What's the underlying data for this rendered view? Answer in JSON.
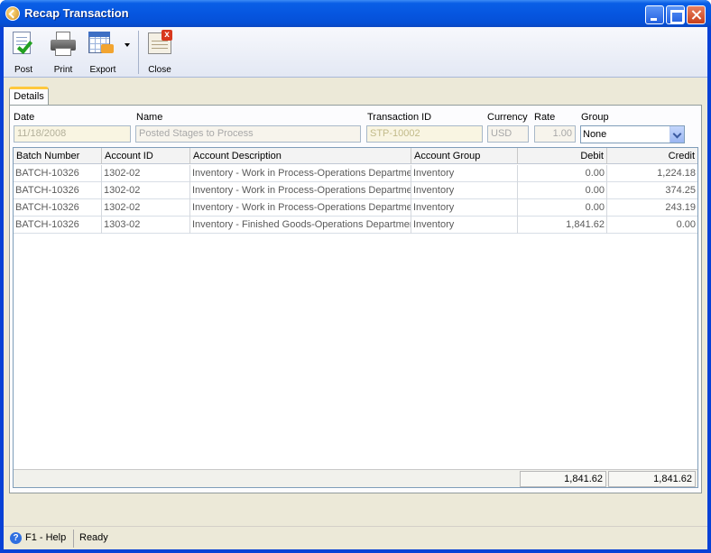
{
  "window": {
    "title": "Recap Transaction"
  },
  "toolbar": {
    "post_label": "Post",
    "print_label": "Print",
    "export_label": "Export",
    "close_label": "Close"
  },
  "tabs": [
    {
      "label": "Details"
    }
  ],
  "form": {
    "date_label": "Date",
    "date_value": "11/18/2008",
    "name_label": "Name",
    "name_value": "Posted Stages to Process",
    "txid_label": "Transaction ID",
    "txid_value": "STP-10002",
    "currency_label": "Currency",
    "currency_value": "USD",
    "rate_label": "Rate",
    "rate_value": "1.00",
    "group_label": "Group",
    "group_value": "None"
  },
  "grid": {
    "columns": [
      "Batch Number",
      "Account ID",
      "Account Description",
      "Account Group",
      "Debit",
      "Credit"
    ],
    "rows": [
      {
        "batch": "BATCH-10326",
        "account_id": "1302-02",
        "description": "Inventory - Work in Process-Operations Departme",
        "group": "Inventory",
        "debit": "0.00",
        "credit": "1,224.18"
      },
      {
        "batch": "BATCH-10326",
        "account_id": "1302-02",
        "description": "Inventory - Work in Process-Operations Departme",
        "group": "Inventory",
        "debit": "0.00",
        "credit": "374.25"
      },
      {
        "batch": "BATCH-10326",
        "account_id": "1302-02",
        "description": "Inventory - Work in Process-Operations Departme",
        "group": "Inventory",
        "debit": "0.00",
        "credit": "243.19"
      },
      {
        "batch": "BATCH-10326",
        "account_id": "1303-02",
        "description": "Inventory - Finished Goods-Operations Departmer",
        "group": "Inventory",
        "debit": "1,841.62",
        "credit": "0.00"
      }
    ],
    "totals": {
      "debit": "1,841.62",
      "credit": "1,841.62"
    }
  },
  "status": {
    "help": "F1 - Help",
    "state": "Ready"
  }
}
